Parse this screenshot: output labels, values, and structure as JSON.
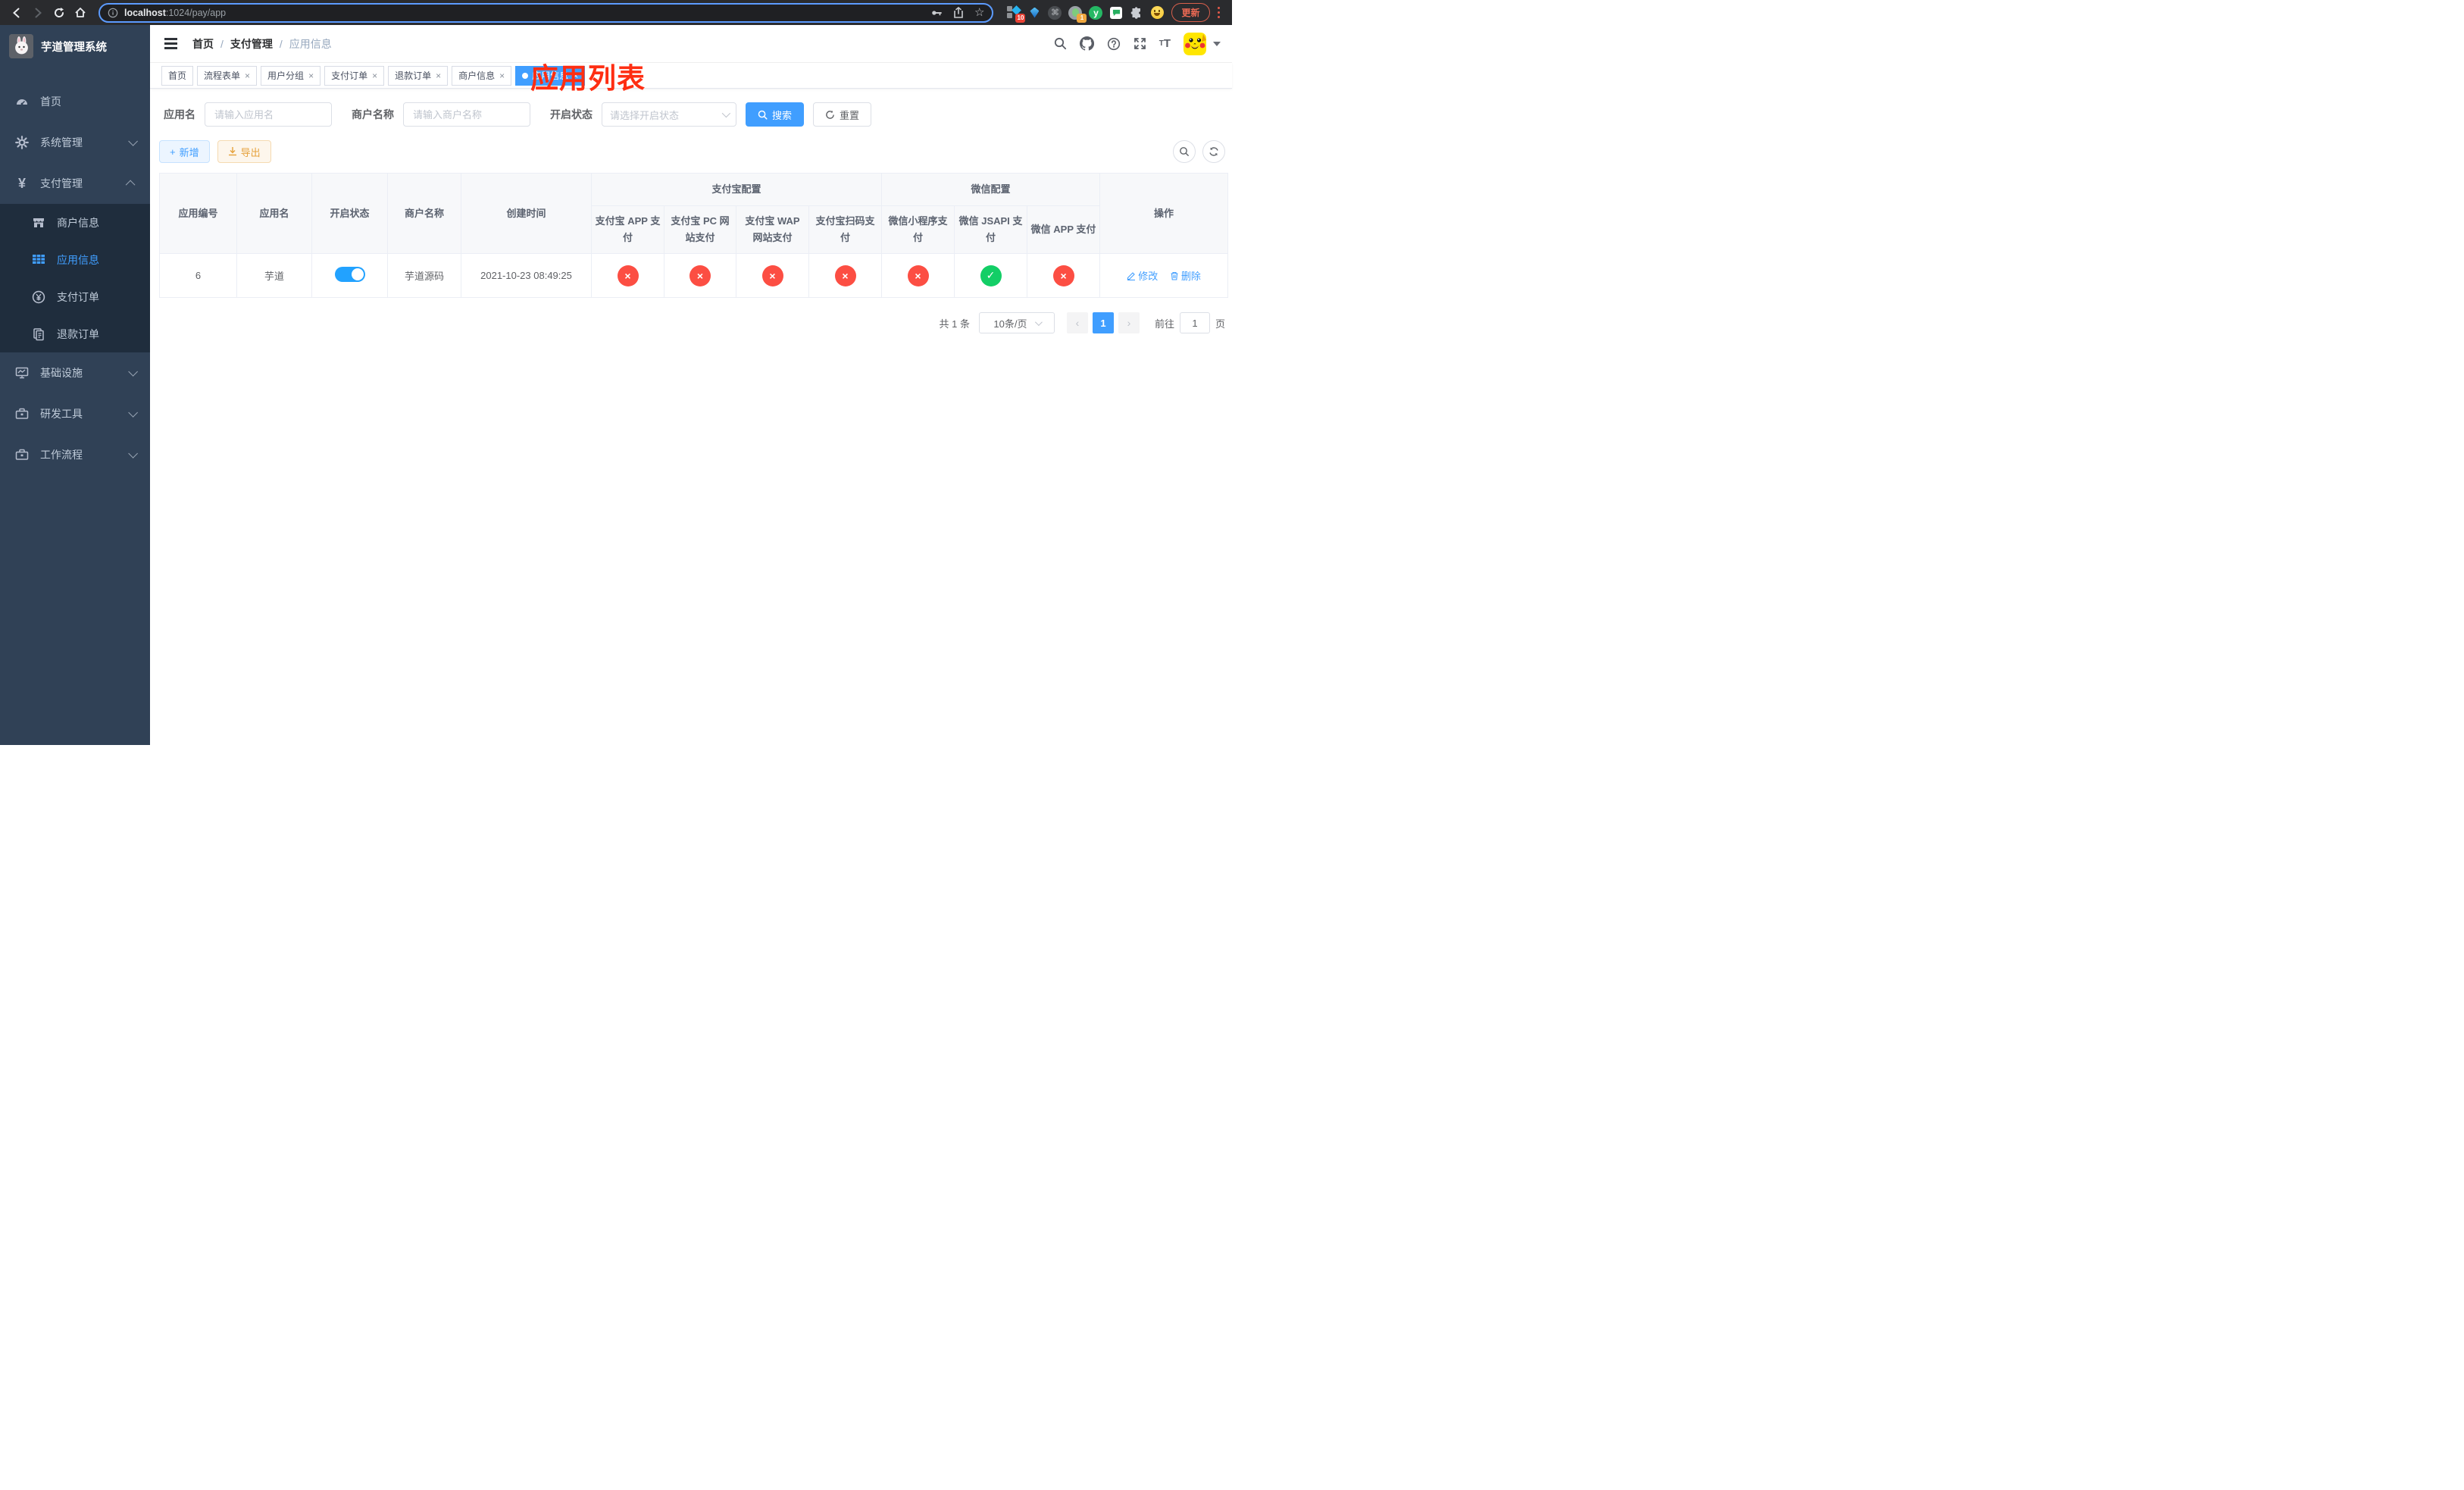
{
  "browser": {
    "url_host": "localhost",
    "url_path": ":1024/pay/app",
    "ext_badge_10": "10",
    "ext_badge_1": "1",
    "ext_y_label": "y",
    "command_glyph": "⌘",
    "star_glyph": "☆",
    "update_button": "更新"
  },
  "sidebar": {
    "title": "芋道管理系统",
    "items": [
      {
        "label": "首页"
      },
      {
        "label": "系统管理"
      },
      {
        "label": "支付管理"
      },
      {
        "label": "商户信息"
      },
      {
        "label": "应用信息"
      },
      {
        "label": "支付订单"
      },
      {
        "label": "退款订单"
      },
      {
        "label": "基础设施"
      },
      {
        "label": "研发工具"
      },
      {
        "label": "工作流程"
      }
    ],
    "yuan_glyph": "¥"
  },
  "header": {
    "breadcrumb": [
      "首页",
      "支付管理",
      "应用信息"
    ],
    "breadcrumb_sep": "/",
    "overlay_title": "应用列表"
  },
  "tabs": [
    {
      "label": "首页"
    },
    {
      "label": "流程表单"
    },
    {
      "label": "用户分组"
    },
    {
      "label": "支付订单"
    },
    {
      "label": "退款订单"
    },
    {
      "label": "商户信息"
    },
    {
      "label": "应用信息"
    }
  ],
  "tab_close_glyph": "×",
  "filters": {
    "app_name_label": "应用名",
    "app_name_placeholder": "请输入应用名",
    "merchant_label": "商户名称",
    "merchant_placeholder": "请输入商户名称",
    "status_label": "开启状态",
    "status_placeholder": "请选择开启状态",
    "search_button": "搜索",
    "reset_button": "重置"
  },
  "toolbar": {
    "add_button": "新增",
    "add_plus": "+",
    "export_button": "导出"
  },
  "table": {
    "group_headers": {
      "alipay": "支付宝配置",
      "wechat": "微信配置"
    },
    "columns": [
      "应用编号",
      "应用名",
      "开启状态",
      "商户名称",
      "创建时间",
      "支付宝 APP 支付",
      "支付宝 PC 网站支付",
      "支付宝 WAP 网站支付",
      "支付宝扫码支付",
      "微信小程序支付",
      "微信 JSAPI 支付",
      "微信 APP 支付",
      "操作"
    ],
    "status_glyphs": {
      "open": "✓",
      "closed": "×"
    },
    "rows": [
      {
        "id": "6",
        "name": "芋道",
        "enabled": true,
        "merchant": "芋道源码",
        "created": "2021-10-23 08:49:25",
        "statuses": [
          "closed",
          "closed",
          "closed",
          "closed",
          "closed",
          "open",
          "closed"
        ],
        "edit_label": "修改",
        "delete_label": "删除"
      }
    ]
  },
  "pagination": {
    "total_text": "共 1 条",
    "page_size": "10条/页",
    "prev_glyph": "‹",
    "next_glyph": "›",
    "current_page": "1",
    "goto_prefix": "前往",
    "goto_value": "1",
    "goto_suffix": "页"
  },
  "colors": {
    "accent": "#409eff",
    "danger": "#fc4e43",
    "success": "#13ce66",
    "warning": "#e6a23c",
    "overlay_red": "#fe2e12",
    "sidebar_bg": "#304156",
    "submenu_bg": "#1f2d3d"
  }
}
